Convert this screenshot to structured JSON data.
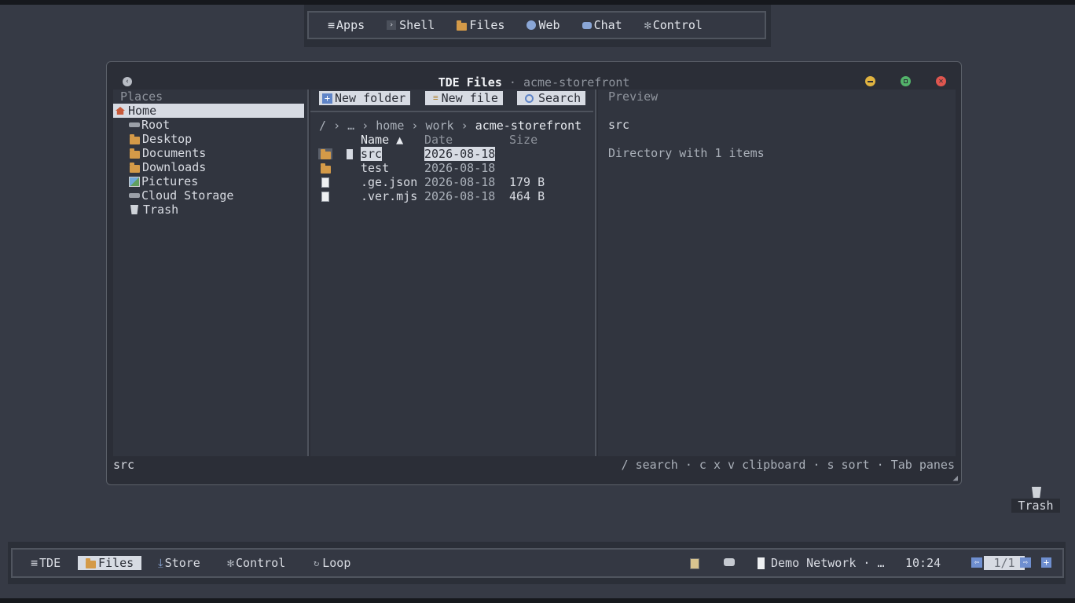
{
  "topmenu": {
    "items": [
      {
        "label": "Apps",
        "icon": "menu-icon"
      },
      {
        "label": "Shell",
        "icon": "terminal-icon"
      },
      {
        "label": "Files",
        "icon": "folder-icon"
      },
      {
        "label": "Web",
        "icon": "globe-icon"
      },
      {
        "label": "Chat",
        "icon": "chat-icon"
      },
      {
        "label": "Control",
        "icon": "gear-icon"
      }
    ]
  },
  "window": {
    "app_title": "TDE Files",
    "separator": "·",
    "subtitle": "acme-storefront",
    "back_icon": "back-icon",
    "buttons": {
      "minimize": "#e0b340",
      "maximize": "#53b36a",
      "close": "#e0564f"
    }
  },
  "places": {
    "heading": "Places",
    "items": [
      {
        "label": "Home",
        "icon": "home-icon",
        "selected": true
      },
      {
        "label": "Root",
        "icon": "drive-icon"
      },
      {
        "label": "Desktop",
        "icon": "folder-icon"
      },
      {
        "label": "Documents",
        "icon": "folder-icon"
      },
      {
        "label": "Downloads",
        "icon": "folder-icon"
      },
      {
        "label": "Pictures",
        "icon": "picture-icon"
      },
      {
        "label": "Cloud Storage",
        "icon": "drive-icon"
      },
      {
        "label": "Trash",
        "icon": "trash-icon"
      }
    ]
  },
  "toolbar": {
    "new_folder": "New folder",
    "new_file": "New file",
    "search": "Search"
  },
  "breadcrumb": {
    "root": "/",
    "sep": "›",
    "ellipsis": "…",
    "parts": [
      "home",
      "work"
    ],
    "current": "acme-storefront"
  },
  "columns": {
    "name": "Name ▲",
    "date": "Date",
    "size": "Size"
  },
  "files": [
    {
      "name": "src",
      "date": "2026-08-18",
      "size": "",
      "type": "folder",
      "selected": true
    },
    {
      "name": "test",
      "date": "2026-08-18",
      "size": "",
      "type": "folder"
    },
    {
      "name": ".ge.json",
      "date": "2026-08-18",
      "size": "179 B",
      "type": "file"
    },
    {
      "name": ".ver.mjs",
      "date": "2026-08-18",
      "size": "464 B",
      "type": "file"
    }
  ],
  "preview": {
    "heading": "Preview",
    "name": "src",
    "description": "Directory with 1 items"
  },
  "status": {
    "left": "src",
    "right": "/ search · c x v clipboard · s sort · Tab panes"
  },
  "desktop": {
    "trash_label": "Trash"
  },
  "taskbar": {
    "items": [
      {
        "label": "TDE",
        "icon": "menu-icon"
      },
      {
        "label": "Files",
        "icon": "folder-icon",
        "active": true
      },
      {
        "label": "Store",
        "icon": "download-icon"
      },
      {
        "label": "Control",
        "icon": "gear-icon"
      },
      {
        "label": "Loop",
        "icon": "loop-icon"
      }
    ],
    "network": "Demo Network · …",
    "clock": "10:24",
    "pager": "1/1"
  }
}
